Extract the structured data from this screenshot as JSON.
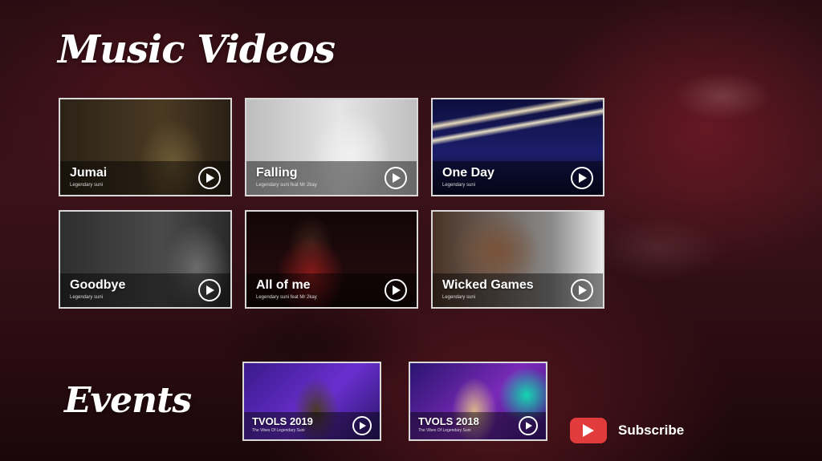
{
  "sections": {
    "music_videos": "Music Videos",
    "events": "Events"
  },
  "music_videos": [
    {
      "title": "Jumai",
      "subtitle": "Legendary suni"
    },
    {
      "title": "Falling",
      "subtitle": "Legendary suni feat Mr 2kay"
    },
    {
      "title": "One Day",
      "subtitle": "Legendary suni"
    },
    {
      "title": "Goodbye",
      "subtitle": "Legendary suni"
    },
    {
      "title": "All of me",
      "subtitle": "Legendary suni feat Mr 2kay"
    },
    {
      "title": "Wicked Games",
      "subtitle": "Legendary suni"
    }
  ],
  "events": [
    {
      "title": "TVOLS 2019",
      "subtitle": "The Vibes Of Legendary Suni"
    },
    {
      "title": "TVOLS 2018",
      "subtitle": "The Vibes Of Legendary Suni"
    }
  ],
  "subscribe": {
    "label": "Subscribe",
    "icon": "youtube-icon",
    "icon_color": "#e23b3b"
  },
  "icons": {
    "play": "play-icon"
  }
}
